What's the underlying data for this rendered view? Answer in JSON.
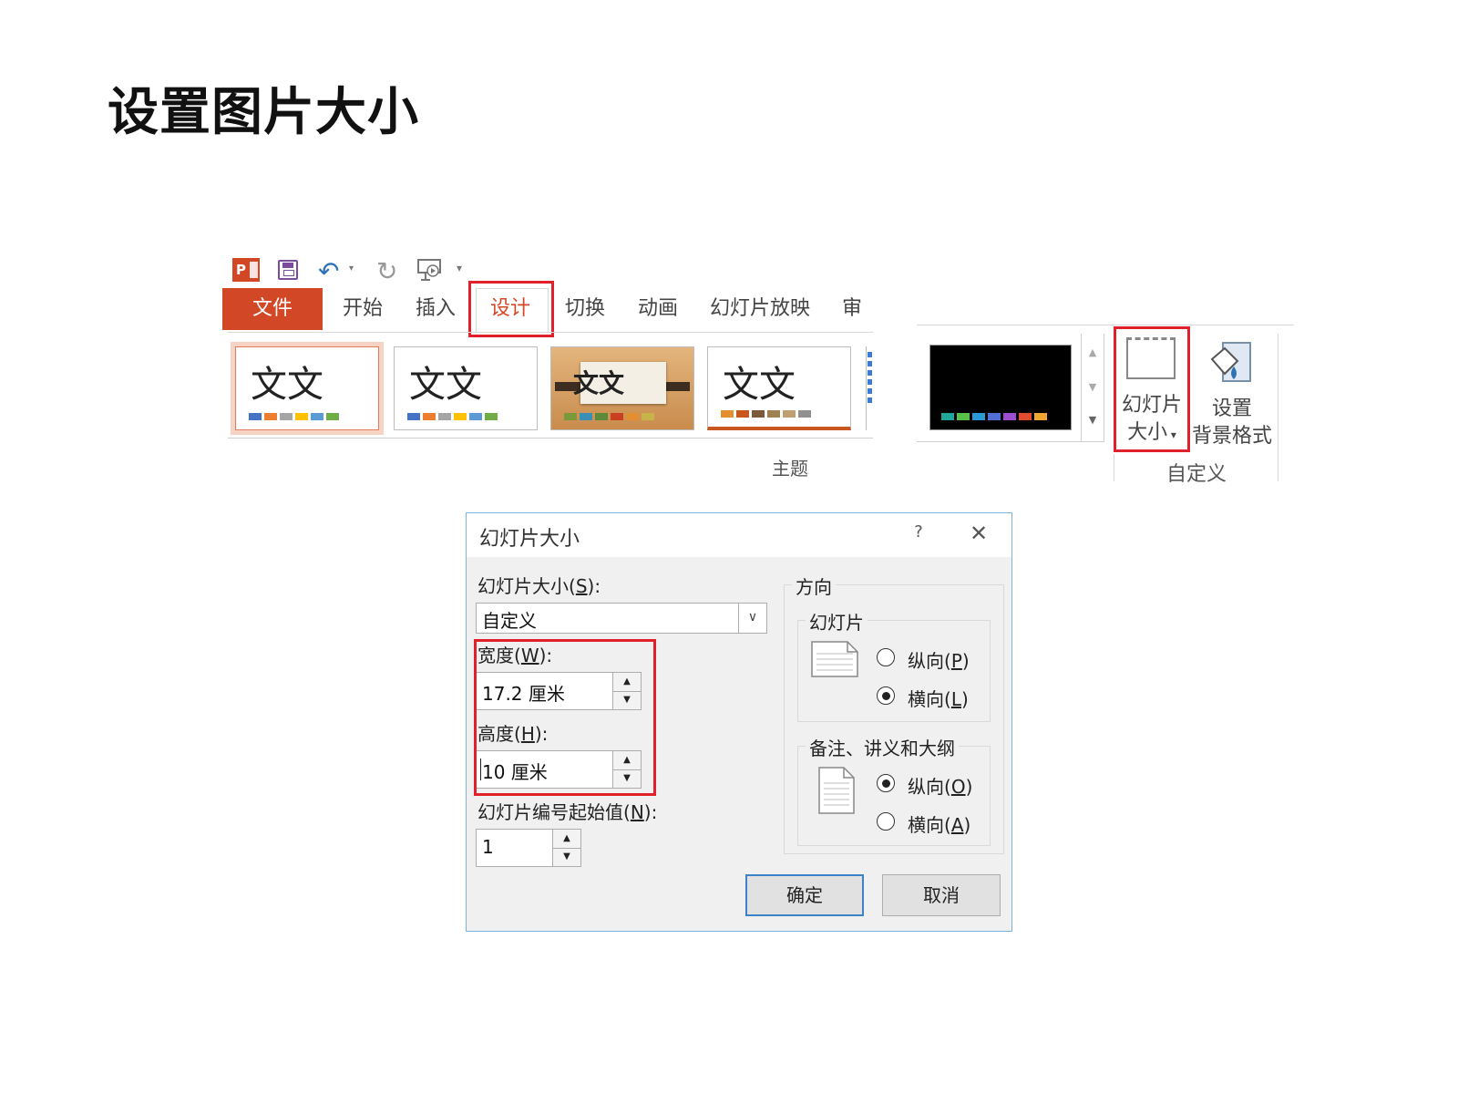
{
  "page": {
    "title": "设置图片大小"
  },
  "qat": {
    "app_logo": "P",
    "icons": [
      "powerpoint-logo-icon",
      "save-icon",
      "undo-icon",
      "redo-icon",
      "start-slideshow-icon",
      "customize-qat-icon"
    ]
  },
  "ribbon": {
    "tabs": [
      {
        "label": "文件"
      },
      {
        "label": "开始"
      },
      {
        "label": "插入"
      },
      {
        "label": "设计"
      },
      {
        "label": "切换"
      },
      {
        "label": "动画"
      },
      {
        "label": "幻灯片放映"
      },
      {
        "label": "审阅"
      }
    ],
    "themes": [
      {
        "sample": "文文",
        "swatches": [
          "#4472c4",
          "#ed7d31",
          "#a5a5a5",
          "#ffc000",
          "#5b9bd5",
          "#70ad47"
        ]
      },
      {
        "sample": "文文",
        "swatches": [
          "#4472c4",
          "#ed7d31",
          "#a5a5a5",
          "#ffc000",
          "#5b9bd5",
          "#70ad47"
        ]
      },
      {
        "sample": "文文",
        "swatches": [
          "#7a9a3a",
          "#3a8fb7",
          "#5a8a3a",
          "#c8401f",
          "#e38f2f",
          "#c7b34a"
        ]
      },
      {
        "sample": "文文",
        "swatches": [
          "#e38f2f",
          "#c8561f",
          "#7a5a3a",
          "#a08050",
          "#c0a070",
          "#909090"
        ]
      }
    ],
    "variant_swatches": [
      "#1fa79a",
      "#5bbf4c",
      "#2a9ad6",
      "#4d6fd6",
      "#9b4fcf",
      "#e04a2f",
      "#f0a530"
    ],
    "theme_group_label": "主题",
    "slide_size_label_line1": "幻灯片",
    "slide_size_label_line2": "大小",
    "bg_format_label_line1": "设置",
    "bg_format_label_line2": "背景格式",
    "custom_group_label": "自定义"
  },
  "dialog": {
    "title": "幻灯片大小",
    "help": "?",
    "close": "✕",
    "size_label_text": "幻灯片大小(",
    "size_label_key": "S",
    "size_label_tail": "):",
    "size_value": "自定义",
    "width_label_text": "宽度(",
    "width_label_key": "W",
    "width_label_tail": "):",
    "width_value": "17.2 厘米",
    "height_label_text": "高度(",
    "height_label_key": "H",
    "height_label_tail": "):",
    "height_value": "10 厘米",
    "numbering_label_text": "幻灯片编号起始值(",
    "numbering_label_key": "N",
    "numbering_label_tail": "):",
    "numbering_value": "1",
    "orientation_title": "方向",
    "slides_group": "幻灯片",
    "slides_portrait_text": "纵向(",
    "slides_portrait_key": "P",
    "slides_landscape_text": "横向(",
    "slides_landscape_key": "L",
    "slides_selected": "landscape",
    "notes_group": "备注、讲义和大纲",
    "notes_portrait_text": "纵向(",
    "notes_portrait_key": "O",
    "notes_landscape_text": "横向(",
    "notes_landscape_key": "A",
    "notes_selected": "portrait",
    "close_paren": ")",
    "ok": "确定",
    "cancel": "取消"
  },
  "colors": {
    "accent_red": "#d24726",
    "highlight_box": "#e0202a",
    "dialog_border": "#79b4e3",
    "ok_border": "#3c82c8"
  }
}
